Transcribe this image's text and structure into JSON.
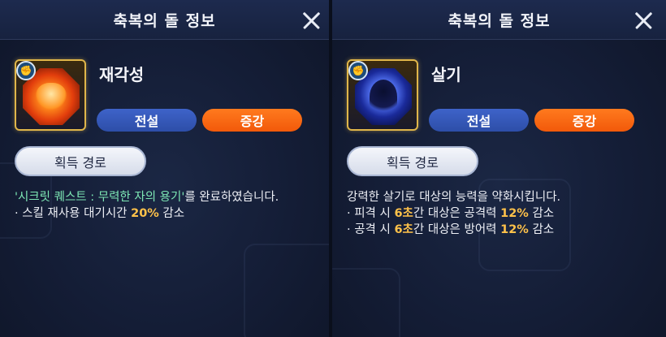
{
  "panels": [
    {
      "title": "축복의 돌 정보",
      "item_name": "재각성",
      "tags": [
        "전설",
        "증강"
      ],
      "acquire_button": "획득 경로",
      "description_lines": [
        {
          "parts": [
            {
              "text": "'시크릿 퀘스트 : 무력한 자의 용기'",
              "style": "green"
            },
            {
              "text": "를 완료하였습니다.",
              "style": "normal"
            }
          ]
        },
        {
          "parts": [
            {
              "text": "· 스킬 재사용 대기시간 ",
              "style": "normal"
            },
            {
              "text": "20%",
              "style": "yellow"
            },
            {
              "text": " 감소",
              "style": "normal"
            }
          ]
        }
      ],
      "icon": "fist-badge-icon",
      "art": "fire-fist-icon"
    },
    {
      "title": "축복의 돌 정보",
      "item_name": "살기",
      "tags": [
        "전설",
        "증강"
      ],
      "acquire_button": "획득 경로",
      "description_lines": [
        {
          "parts": [
            {
              "text": "강력한 살기로 대상의 능력을 약화시킵니다.",
              "style": "normal"
            }
          ]
        },
        {
          "parts": [
            {
              "text": "· 피격 시 ",
              "style": "normal"
            },
            {
              "text": "6초",
              "style": "yellow"
            },
            {
              "text": "간 대상은 공격력 ",
              "style": "normal"
            },
            {
              "text": "12%",
              "style": "yellow"
            },
            {
              "text": " 감소",
              "style": "normal"
            }
          ]
        },
        {
          "parts": [
            {
              "text": "· 공격 시 ",
              "style": "normal"
            },
            {
              "text": "6초",
              "style": "yellow"
            },
            {
              "text": "간 대상은 방어력 ",
              "style": "normal"
            },
            {
              "text": "12%",
              "style": "yellow"
            },
            {
              "text": " 감소",
              "style": "normal"
            }
          ]
        }
      ],
      "icon": "fist-badge-icon",
      "art": "dark-aura-icon"
    }
  ],
  "colors": {
    "legend_tag": "#3e63c9",
    "augment_tag": "#ff7a1e",
    "highlight_green": "#7ee8b5",
    "highlight_yellow": "#ffc24a",
    "icon_border": "#e0b64a"
  }
}
